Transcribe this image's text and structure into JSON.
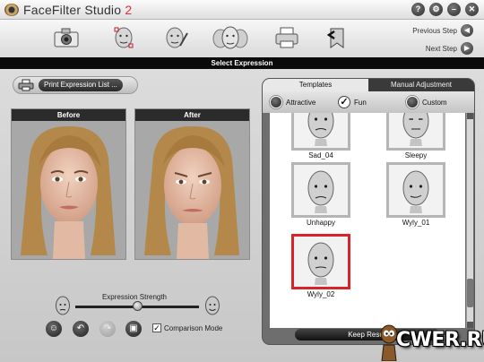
{
  "window": {
    "title": "FaceFilter Studio",
    "version": "2",
    "buttons": [
      "?",
      "⚙",
      "–",
      "✕"
    ]
  },
  "toolbar": {
    "tools": [
      "camera-icon",
      "face-select-icon",
      "face-adjust-icon",
      "expressions-icon",
      "printer-icon",
      "save-export-icon"
    ],
    "previous_step": "Previous Step",
    "next_step": "Next Step"
  },
  "header": {
    "title": "Select Expression"
  },
  "main": {
    "print_button": "Print Expression List ...",
    "before_label": "Before",
    "after_label": "After",
    "strength_label": "Expression Strength",
    "strength_value": 0.5,
    "comparison_label": "Comparison Mode",
    "comparison_checked": true,
    "buttons": [
      "smile-face-icon",
      "undo-icon",
      "redo-icon",
      "save-icon"
    ]
  },
  "templates": {
    "tabs": [
      "Templates",
      "Manual Adjustment"
    ],
    "active_tab": 0,
    "categories": [
      "Attractive",
      "Fun",
      "Custom"
    ],
    "selected_category": "Fun",
    "items": [
      "Sad_04",
      "Sleepy",
      "Unhappy",
      "Wyly_01",
      "Wyly_02"
    ],
    "selected_item": "Wyly_02",
    "keep_button": "Keep Result"
  },
  "watermark": "CWER.RU",
  "colors": {
    "accent_red": "#d9232a",
    "version_red": "#e0303a",
    "dark_bar": "#0a0a0a"
  }
}
